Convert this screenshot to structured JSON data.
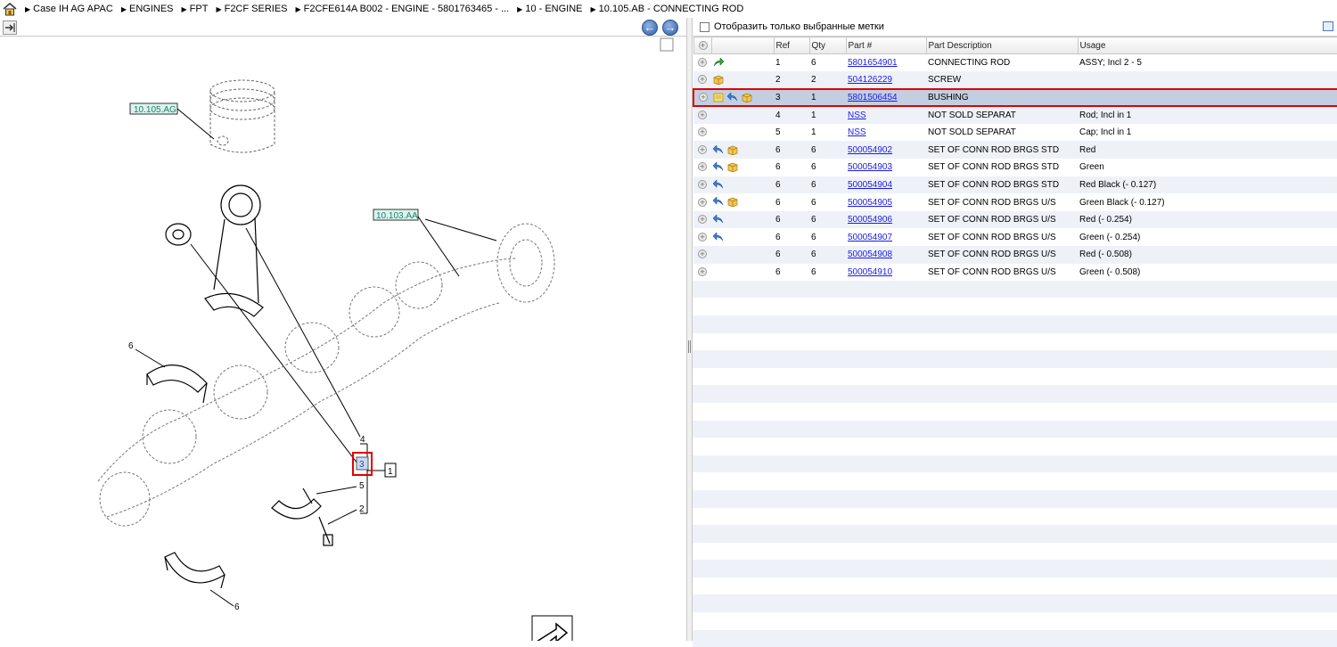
{
  "breadcrumb": [
    "Case IH AG APAC",
    "ENGINES",
    "FPT",
    "F2CF SERIES",
    "F2CFE614A B002 - ENGINE - 5801763465 - ...",
    "10 - ENGINE",
    "10.105.AB - CONNECTING ROD"
  ],
  "diagram": {
    "ref_labels": {
      "piston": "10.105.AG",
      "crank": "10.103.AA"
    },
    "callouts": {
      "c6a": "6",
      "c6b": "6",
      "c4": "4",
      "c3": "3",
      "c1": "1",
      "c5": "5",
      "c2": "2"
    }
  },
  "filter": {
    "label": "Отобразить только выбранные метки"
  },
  "columns": {
    "ref": "Ref",
    "qty": "Qty",
    "part": "Part #",
    "desc": "Part Description",
    "usage": "Usage"
  },
  "rows": [
    {
      "icons": [
        "green-arrow-icon"
      ],
      "ref": "1",
      "qty": "6",
      "part": "5801654901",
      "desc": "CONNECTING ROD",
      "usage": "ASSY; Incl 2 - 5"
    },
    {
      "icons": [
        "box-icon"
      ],
      "ref": "2",
      "qty": "2",
      "part": "504126229",
      "desc": "SCREW",
      "usage": ""
    },
    {
      "icons": [
        "note-icon",
        "blue-arrow-icon",
        "box-icon"
      ],
      "ref": "3",
      "qty": "1",
      "part": "5801506454",
      "desc": "BUSHING",
      "usage": "",
      "selected": true
    },
    {
      "icons": [],
      "ref": "4",
      "qty": "1",
      "part": "NSS",
      "desc": "NOT SOLD SEPARAT",
      "usage": "Rod; Incl in 1"
    },
    {
      "icons": [],
      "ref": "5",
      "qty": "1",
      "part": "NSS",
      "desc": "NOT SOLD SEPARAT",
      "usage": "Cap; Incl in 1"
    },
    {
      "icons": [
        "blue-arrow-icon",
        "box-icon"
      ],
      "ref": "6",
      "qty": "6",
      "part": "500054902",
      "desc": "SET OF CONN ROD BRGS STD",
      "usage": "Red"
    },
    {
      "icons": [
        "blue-arrow-icon",
        "box-icon"
      ],
      "ref": "6",
      "qty": "6",
      "part": "500054903",
      "desc": "SET OF CONN ROD BRGS STD",
      "usage": "Green"
    },
    {
      "icons": [
        "blue-arrow-icon"
      ],
      "ref": "6",
      "qty": "6",
      "part": "500054904",
      "desc": "SET OF CONN ROD BRGS STD",
      "usage": "Red Black (- 0.127)"
    },
    {
      "icons": [
        "blue-arrow-icon",
        "box-icon"
      ],
      "ref": "6",
      "qty": "6",
      "part": "500054905",
      "desc": "SET OF CONN ROD BRGS U/S",
      "usage": "Green Black  (- 0.127)"
    },
    {
      "icons": [
        "blue-arrow-icon"
      ],
      "ref": "6",
      "qty": "6",
      "part": "500054906",
      "desc": "SET OF CONN ROD BRGS U/S",
      "usage": "Red  (- 0.254)"
    },
    {
      "icons": [
        "blue-arrow-icon"
      ],
      "ref": "6",
      "qty": "6",
      "part": "500054907",
      "desc": "SET OF CONN ROD BRGS U/S",
      "usage": "Green  (- 0.254)"
    },
    {
      "icons": [],
      "ref": "6",
      "qty": "6",
      "part": "500054908",
      "desc": "SET OF CONN ROD BRGS U/S",
      "usage": "Red  (- 0.508)"
    },
    {
      "icons": [],
      "ref": "6",
      "qty": "6",
      "part": "500054910",
      "desc": "SET OF CONN ROD BRGS U/S",
      "usage": "Green  (- 0.508)"
    }
  ],
  "colors": {
    "selection": "#e00000",
    "link": "#1a1aee",
    "row_stripe": "#eef2f8",
    "selected_row": "#c3cfe0",
    "label_fill": "#d8f5f0"
  }
}
